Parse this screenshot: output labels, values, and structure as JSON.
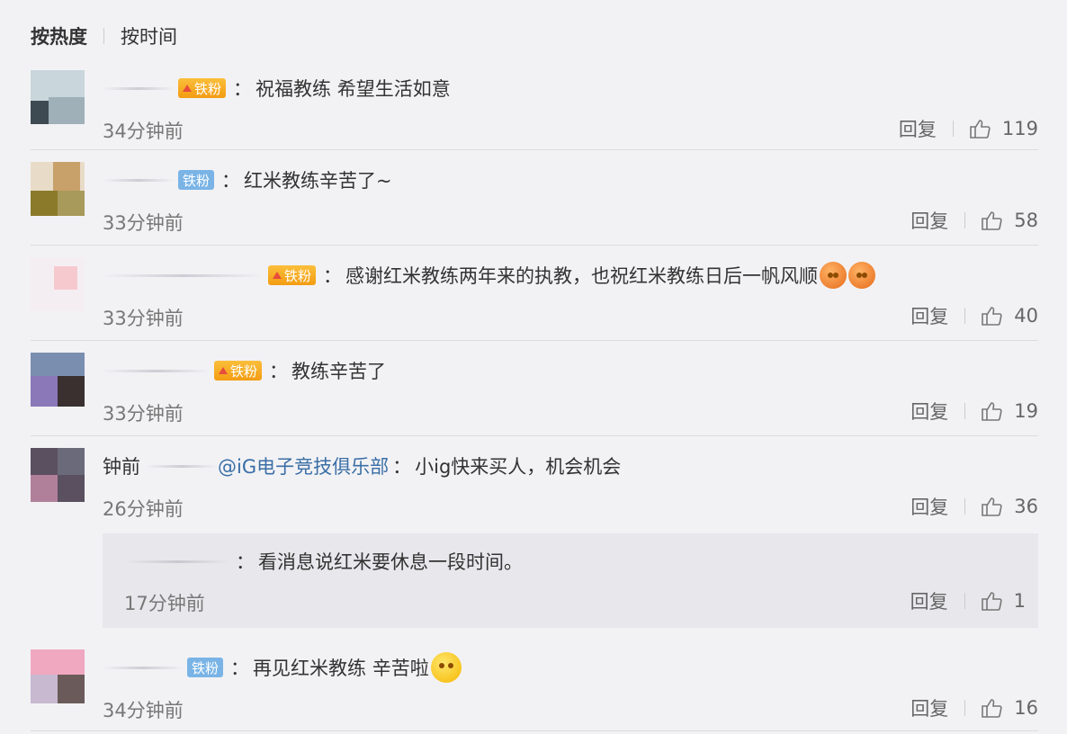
{
  "tabs": {
    "hot": "按热度",
    "time": "按时间"
  },
  "badge": {
    "fan": "铁粉"
  },
  "reply_label": "回复",
  "comments": [
    {
      "text": "祝福教练 希望生活如意",
      "time": "34分钟前",
      "likes": "119"
    },
    {
      "text": "红米教练辛苦了~",
      "time": "33分钟前",
      "likes": "58"
    },
    {
      "text": "感谢红米教练两年来的执教，也祝红米教练日后一帆风顺",
      "time": "33分钟前",
      "likes": "40"
    },
    {
      "text": "教练辛苦了",
      "time": "33分钟前",
      "likes": "19"
    },
    {
      "mention": "@iG电子竞技俱乐部",
      "text": "小ig快来买人，机会机会",
      "time": "26分钟前",
      "likes": "36",
      "name_fragment": "钟前"
    },
    {
      "text": "再见红米教练 辛苦啦",
      "time": "34分钟前",
      "likes": "16"
    }
  ],
  "reply": {
    "text": "看消息说红米要休息一段时间。",
    "time": "17分钟前",
    "likes": "1"
  },
  "colors": {
    "badge_gold": "#f39c12",
    "badge_blue": "#7ab4e6",
    "link": "#3a6ea5",
    "background": "#f2f2f5"
  },
  "icons": {
    "like": "thumbs-up-icon",
    "emoji": "face-emoji-icon"
  }
}
